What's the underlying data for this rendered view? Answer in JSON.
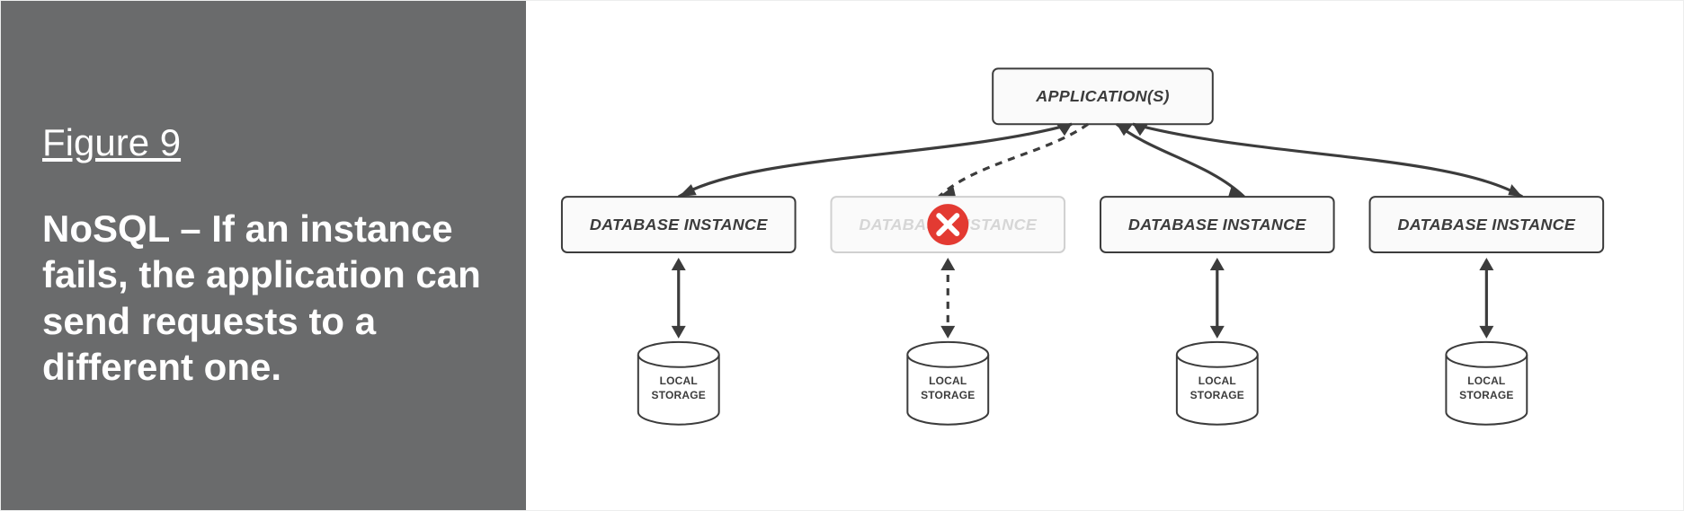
{
  "figure": {
    "label": "Figure 9",
    "caption": "NoSQL – If an instance fails, the application can send requests to a different one."
  },
  "diagram": {
    "app_label": "APPLICATION(S)",
    "db_label": "DATABASE INSTANCE",
    "storage_label_line1": "LOCAL",
    "storage_label_line2": "STORAGE",
    "nodes": [
      {
        "id": "db1",
        "failed": false
      },
      {
        "id": "db2",
        "failed": true
      },
      {
        "id": "db3",
        "failed": false
      },
      {
        "id": "db4",
        "failed": false
      }
    ],
    "icons": {
      "fail": "error-circle-x"
    }
  }
}
